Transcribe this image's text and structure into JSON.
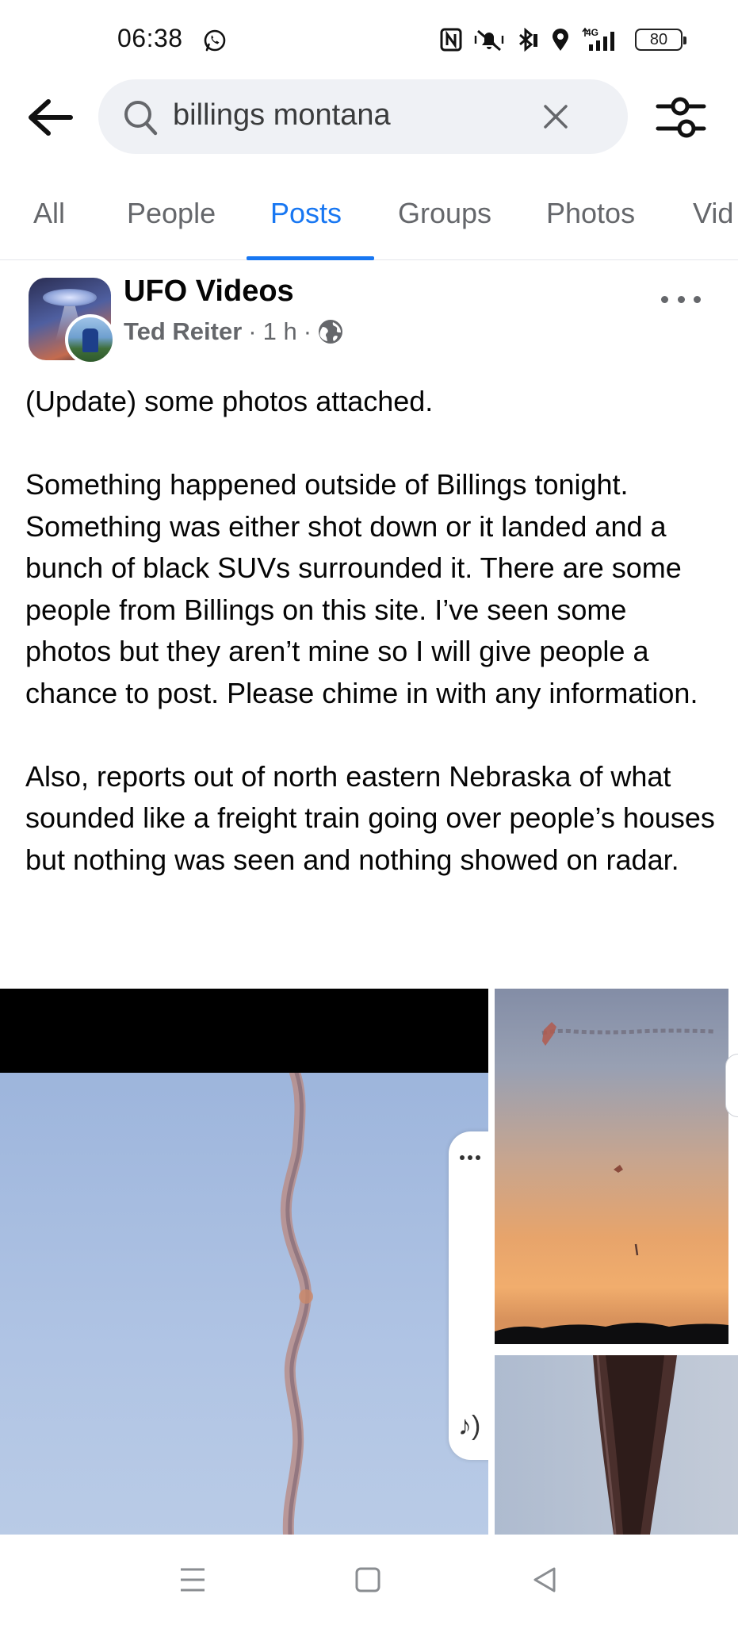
{
  "status_bar": {
    "time": "06:38",
    "battery": "80",
    "icons": [
      "whatsapp-icon",
      "nfc-icon",
      "vibrate-icon",
      "bluetooth-icon",
      "location-icon",
      "signal-4g-icon",
      "battery-icon"
    ]
  },
  "search": {
    "query": "billings montana",
    "icons": [
      "back-arrow-icon",
      "search-icon",
      "close-icon",
      "filter-icon"
    ]
  },
  "tabs": [
    {
      "label": "All"
    },
    {
      "label": "People"
    },
    {
      "label": "Posts",
      "active": true
    },
    {
      "label": "Groups"
    },
    {
      "label": "Photos"
    },
    {
      "label": "Vid"
    }
  ],
  "post": {
    "group_name": "UFO Videos",
    "author": "Ted Reiter",
    "separator": "·",
    "time": "1 h",
    "audience_icon": "globe-icon",
    "paragraphs": [
      "(Update) some photos attached.",
      "Something happened outside of Billings tonight.  Something was either shot down or it landed and a bunch of black SUVs surrounded it.  There are some people from Billings on this site.  I’ve seen some photos but they aren’t mine so I will give people a chance to post.  Please chime in with any information.",
      "Also, reports out of north eastern Nebraska of what sounded like a freight train going over people’s houses but nothing was seen and nothing showed on radar."
    ]
  },
  "overlay": {
    "music_glyph": "♪)"
  },
  "nav_bar": {
    "icons": [
      "menu-icon",
      "home-square-icon",
      "back-triangle-icon"
    ]
  },
  "colors": {
    "accent": "#1877f2",
    "secondary_text": "#65676b",
    "search_bg": "#eff1f5"
  }
}
